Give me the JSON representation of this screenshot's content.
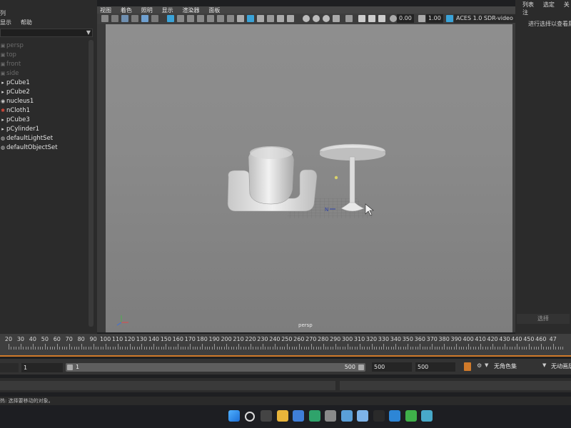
{
  "outliner": {
    "title": "列",
    "menu": [
      "显示",
      "帮助"
    ],
    "search_placeholder": "",
    "items": [
      {
        "label": "persp",
        "dim": true,
        "icon": "camera-icon"
      },
      {
        "label": "top",
        "dim": true,
        "icon": "camera-icon"
      },
      {
        "label": "front",
        "dim": true,
        "icon": "camera-icon"
      },
      {
        "label": "side",
        "dim": true,
        "icon": "camera-icon"
      },
      {
        "label": "pCube1",
        "dim": false,
        "icon": "mesh-icon"
      },
      {
        "label": "pCube2",
        "dim": false,
        "icon": "mesh-icon"
      },
      {
        "label": "nucleus1",
        "dim": false,
        "icon": "nucleus-icon"
      },
      {
        "label": "nCloth1",
        "dim": false,
        "icon": "ncloth-icon"
      },
      {
        "label": "pCube3",
        "dim": false,
        "icon": "mesh-icon"
      },
      {
        "label": "pCylinder1",
        "dim": false,
        "icon": "mesh-icon"
      },
      {
        "label": "defaultLightSet",
        "dim": false,
        "icon": "set-icon"
      },
      {
        "label": "defaultObjectSet",
        "dim": false,
        "icon": "set-icon"
      }
    ]
  },
  "viewport": {
    "menu": [
      "视图",
      "着色",
      "照明",
      "显示",
      "渲染器",
      "面板"
    ],
    "exposure": "0.00",
    "gamma": "1.00",
    "color_space": "ACES 1.0 SDR-video (sl",
    "camera_label": "persp"
  },
  "right_panel": {
    "tabs": [
      "列表",
      "选定",
      "关注"
    ],
    "info": "进行选择以查看属",
    "select_button": "选择"
  },
  "timeline": {
    "ticks": [
      "20",
      "30",
      "40",
      "50",
      "60",
      "70",
      "80",
      "90",
      "100",
      "110",
      "120",
      "130",
      "140",
      "150",
      "160",
      "170",
      "180",
      "190",
      "200",
      "210",
      "220",
      "230",
      "240",
      "250",
      "260",
      "270",
      "280",
      "290",
      "300",
      "310",
      "320",
      "330",
      "340",
      "350",
      "360",
      "370",
      "380",
      "390",
      "400",
      "410",
      "420",
      "430",
      "440",
      "450",
      "460",
      "47"
    ]
  },
  "range": {
    "start_field": "1",
    "slider_start": "1",
    "slider_end": "500",
    "end_field": "500",
    "anim_end_field": "500",
    "character_set": "无角色集",
    "anim_layer": "无动画层"
  },
  "help_line": "热: 选择要移动的对象。",
  "taskbar": {
    "icons": [
      "windows-start-icon",
      "search-icon",
      "task-view-icon",
      "file-explorer-icon",
      "store-icon",
      "edge-icon",
      "settings-icon",
      "photos-icon",
      "cloud-icon",
      "app-icon",
      "pen-icon",
      "wechat-icon",
      "maya-icon"
    ]
  },
  "colors": {
    "accent_blue": "#3aa3d8",
    "timeline_orange": "#d07a2a",
    "viewport_gray": "#8b8b8b"
  }
}
